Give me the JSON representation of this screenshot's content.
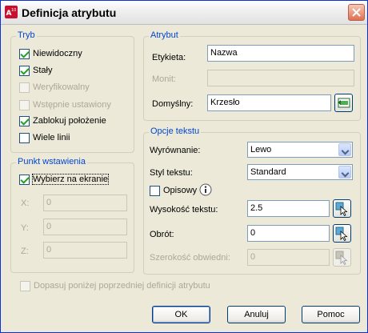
{
  "title": "Definicja atrybutu",
  "icons": {
    "app": "autocad-app-icon",
    "close": "close-icon",
    "pick": "pick-point-icon",
    "field": "insert-field-icon",
    "info": "info-icon"
  },
  "mode": {
    "title": "Tryb",
    "options": [
      {
        "label": "Niewidoczny",
        "checked": true,
        "enabled": true
      },
      {
        "label": "Stały",
        "checked": true,
        "enabled": true
      },
      {
        "label": "Weryfikowalny",
        "checked": false,
        "enabled": false
      },
      {
        "label": "Wstępnie ustawiony",
        "checked": false,
        "enabled": false
      },
      {
        "label": "Zablokuj położenie",
        "checked": true,
        "enabled": true
      },
      {
        "label": "Wiele linii",
        "checked": false,
        "enabled": true
      }
    ]
  },
  "insertion": {
    "title": "Punkt wstawienia",
    "on_screen_label": "Wybierz na ekranie",
    "on_screen_checked": true,
    "x_label": "X:",
    "x_value": "0",
    "y_label": "Y:",
    "y_value": "0",
    "z_label": "Z:",
    "z_value": "0"
  },
  "attribute": {
    "title": "Atrybut",
    "tag_label": "Etykieta:",
    "tag_value": "Nazwa",
    "prompt_label": "Monit:",
    "prompt_value": "",
    "default_label": "Domyślny:",
    "default_value": "Krzesło"
  },
  "text_options": {
    "title": "Opcje tekstu",
    "justification_label": "Wyrównanie:",
    "justification_value": "Lewo",
    "style_label": "Styl tekstu:",
    "style_value": "Standard",
    "annotative_label": "Opisowy",
    "annotative_checked": false,
    "height_label": "Wysokość tekstu:",
    "height_value": "2.5",
    "rotation_label": "Obrót:",
    "rotation_value": "0",
    "width_label": "Szerokość obwiedni:",
    "width_value": "0"
  },
  "align_below": {
    "label": "Dopasuj poniżej poprzedniej definicji atrybutu",
    "checked": false,
    "enabled": false
  },
  "buttons": {
    "ok": "OK",
    "cancel": "Anuluj",
    "help": "Pomoc"
  }
}
